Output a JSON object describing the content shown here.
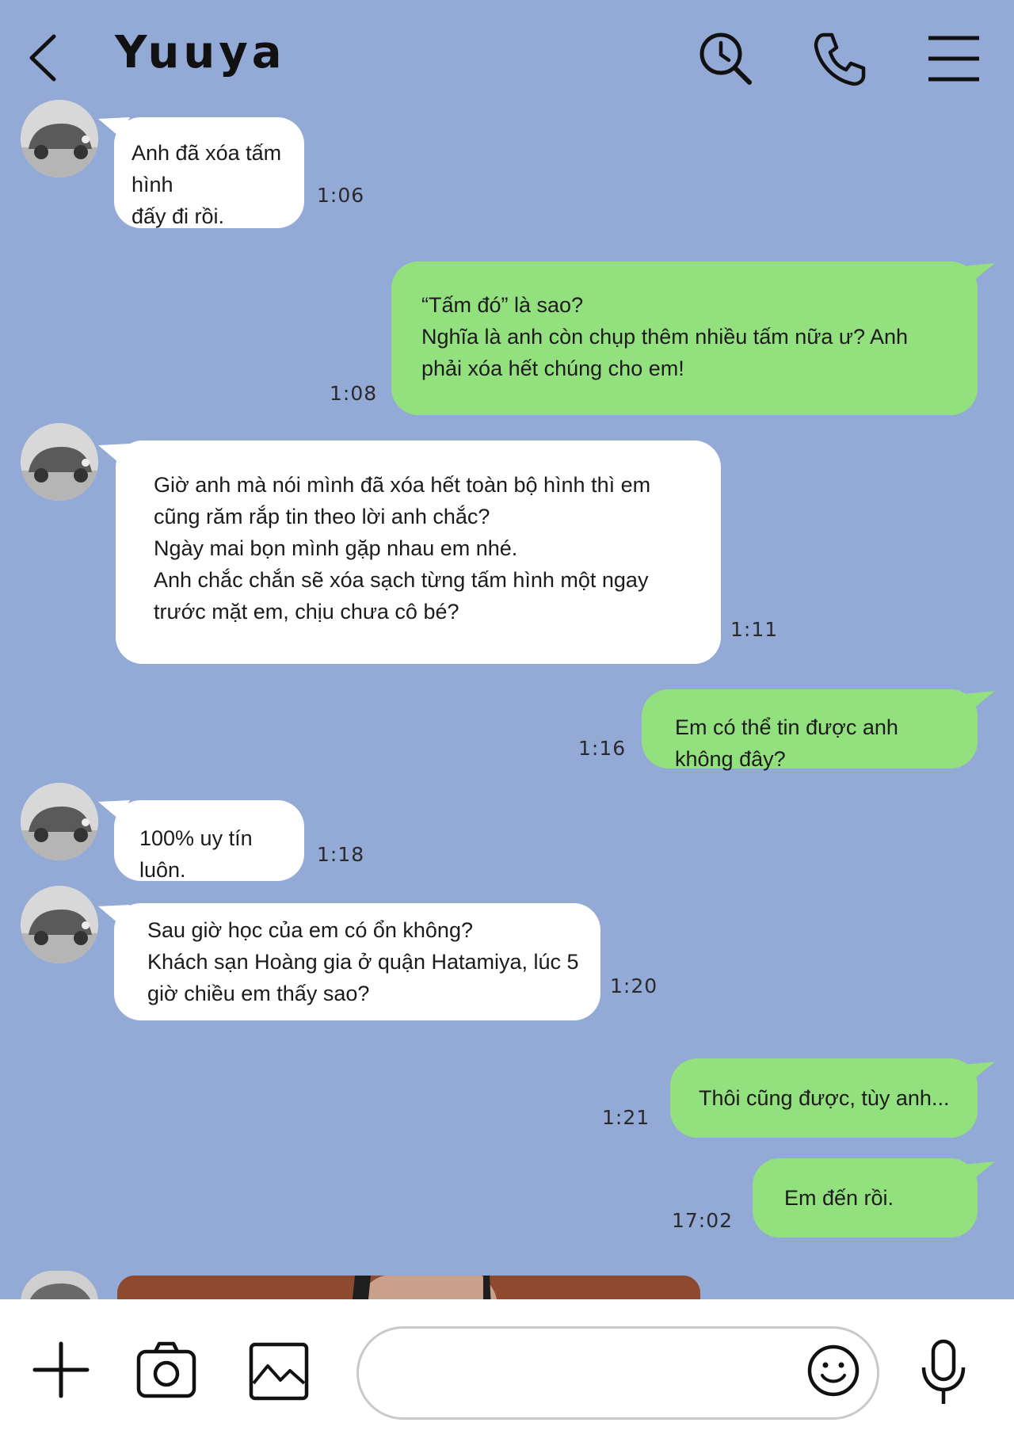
{
  "header": {
    "contact_name": "Yuuya",
    "icons": [
      "back-chevron-icon",
      "search-history-icon",
      "phone-icon",
      "menu-icon"
    ]
  },
  "messages": [
    {
      "sender": "Yuuya",
      "direction": "in",
      "text": "Anh đã xóa tấm hình\nđấy đi rồi.",
      "time": "1:06"
    },
    {
      "sender": "me",
      "direction": "out",
      "text": "“Tấm đó” là sao?\nNghĩa là anh còn chụp thêm nhiều tấm nữa ư? Anh phải xóa hết chúng cho em!",
      "time": "1:08"
    },
    {
      "sender": "Yuuya",
      "direction": "in",
      "text": "Giờ anh mà nói mình đã xóa hết toàn bộ hình thì em cũng răm rắp tin theo lời anh chắc?\nNgày mai bọn mình gặp nhau em nhé.\nAnh chắc chắn sẽ xóa sạch từng tấm hình một ngay trước mặt em, chịu chưa cô bé?",
      "time": "1:11"
    },
    {
      "sender": "me",
      "direction": "out",
      "text": "Em có thể tin được anh không đây?",
      "time": "1:16"
    },
    {
      "sender": "Yuuya",
      "direction": "in",
      "text": "100% uy tín luôn.",
      "time": "1:18"
    },
    {
      "sender": "Yuuya",
      "direction": "in",
      "text": "Sau giờ học của em có ổn không?\nKhách sạn Hoàng gia ở quận Hatamiya, lúc 5 giờ chiều em thấy sao?",
      "time": "1:20"
    },
    {
      "sender": "me",
      "direction": "out",
      "text": "Thôi cũng được, tùy anh...",
      "time": "1:21"
    },
    {
      "sender": "me",
      "direction": "out",
      "text": "Em đến rồi.",
      "time": "17:02"
    }
  ],
  "footer": {
    "input_value": "",
    "icons": [
      "plus-icon",
      "camera-icon",
      "image-icon",
      "emoji-icon",
      "microphone-icon"
    ]
  },
  "colors": {
    "background": "#93a9d6",
    "incoming_bubble": "#ffffff",
    "outgoing_bubble": "#93e07e",
    "footer": "#ffffff"
  }
}
